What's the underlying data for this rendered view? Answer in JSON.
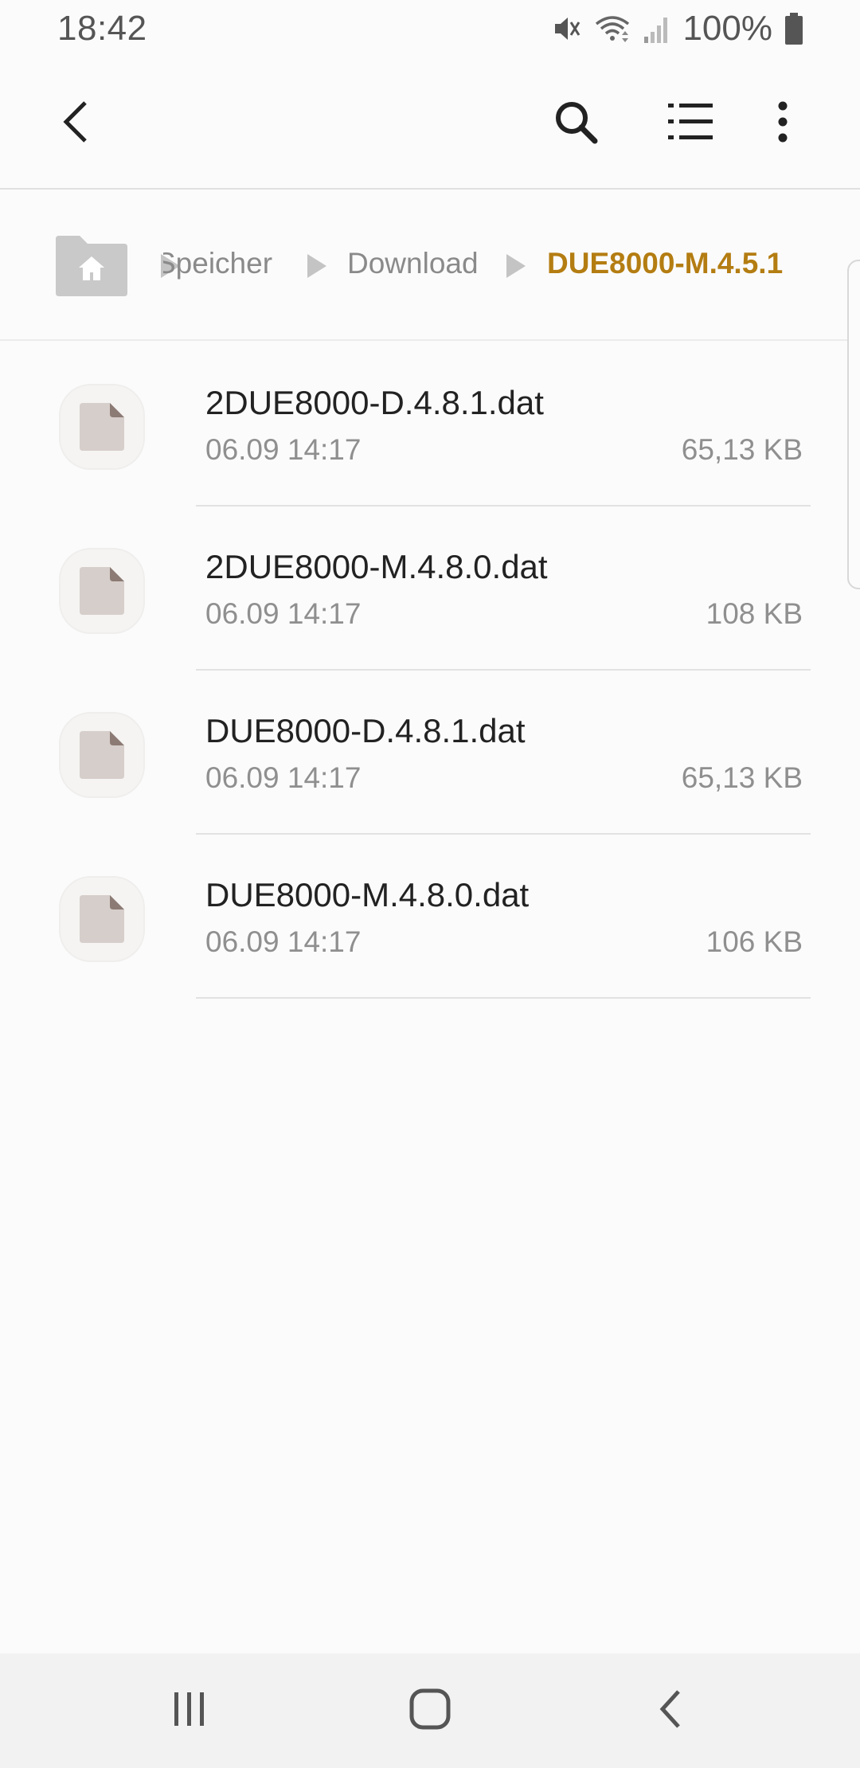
{
  "status_bar": {
    "time": "18:42",
    "battery": "100%",
    "icons": [
      "mute-icon",
      "wifi-icon",
      "signal-icon",
      "battery-icon"
    ]
  },
  "app_bar": {
    "icons": [
      "back-arrow-icon",
      "search-icon",
      "list-view-icon",
      "more-options-icon"
    ]
  },
  "breadcrumb": {
    "home_icon": "home-folder-icon",
    "items": [
      "Speicher",
      "Download",
      "DUE8000-M.4.5.1"
    ],
    "active_color": "#b47d12"
  },
  "files": [
    {
      "name": "2DUE8000-D.4.8.1.dat",
      "date": "06.09 14:17",
      "size": "65,13 KB"
    },
    {
      "name": "2DUE8000-M.4.8.0.dat",
      "date": "06.09 14:17",
      "size": "108 KB"
    },
    {
      "name": "DUE8000-D.4.8.1.dat",
      "date": "06.09 14:17",
      "size": "65,13 KB"
    },
    {
      "name": "DUE8000-M.4.8.0.dat",
      "date": "06.09 14:17",
      "size": "106 KB"
    }
  ],
  "nav_bar": {
    "icons": [
      "recent-apps-icon",
      "home-icon",
      "back-icon"
    ]
  }
}
